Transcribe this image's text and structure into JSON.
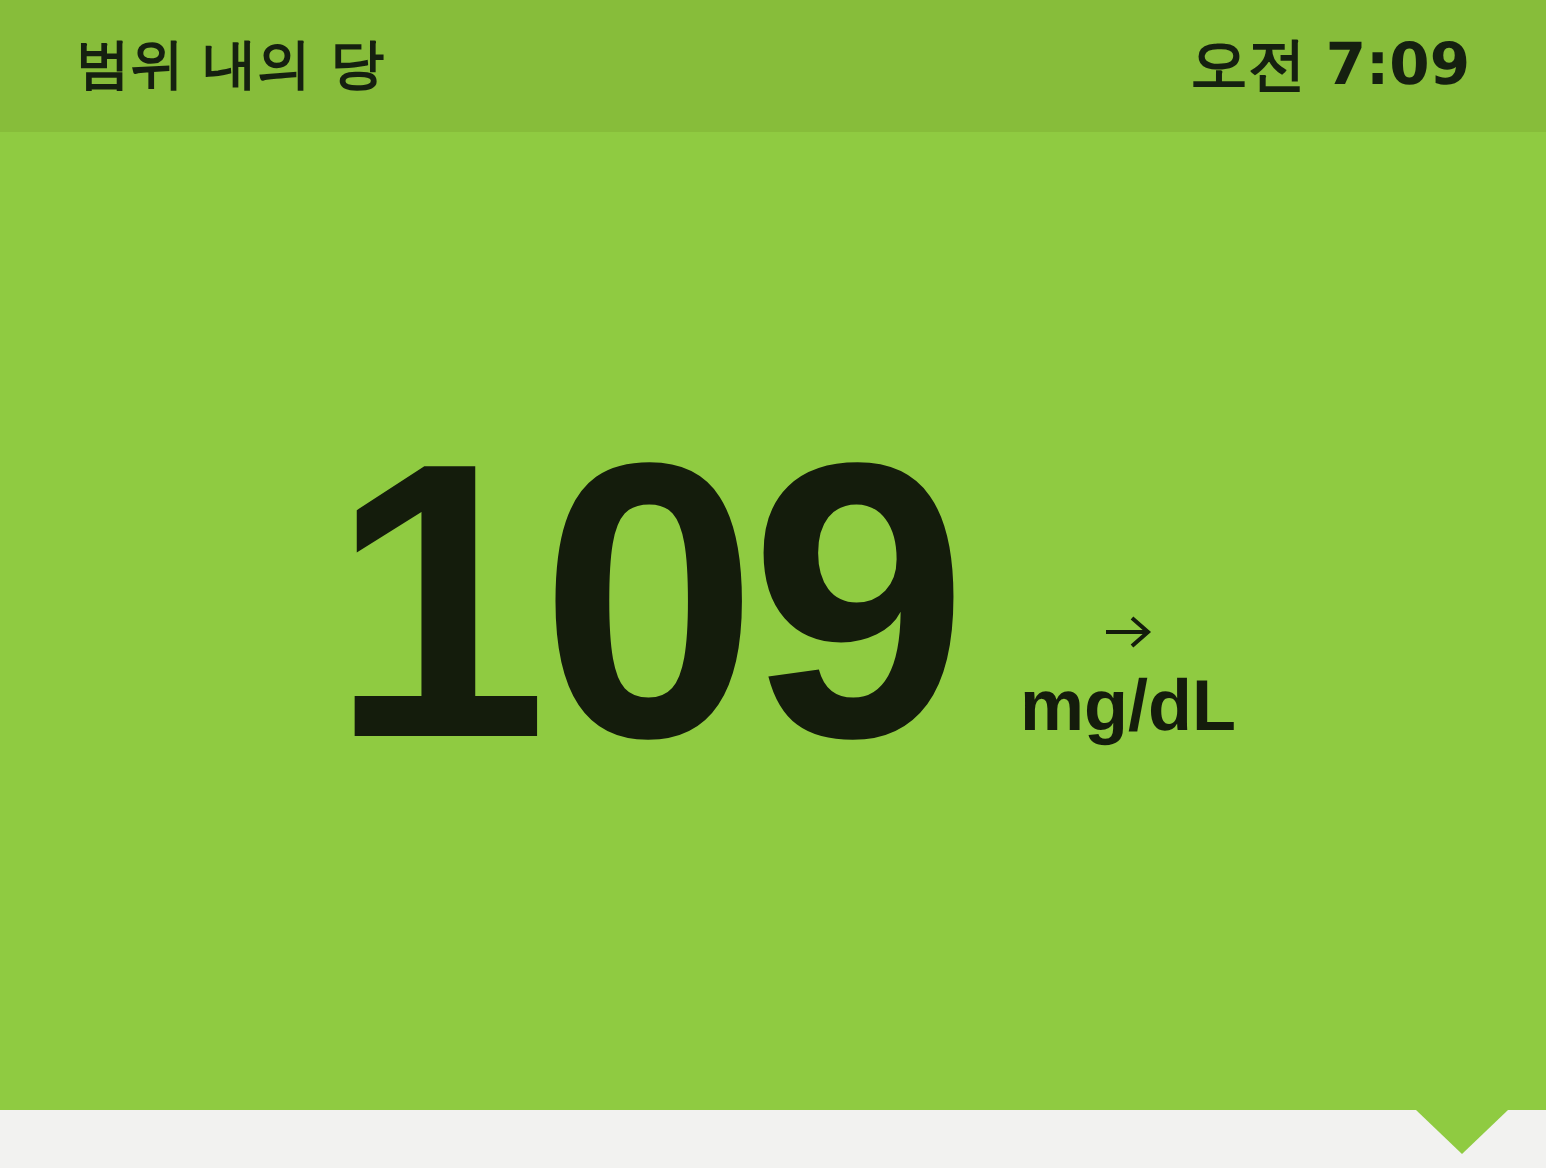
{
  "header": {
    "title": "범위 내의 당",
    "time": "오전 7:09"
  },
  "reading": {
    "value": "109",
    "unit": "mg/dL"
  }
}
